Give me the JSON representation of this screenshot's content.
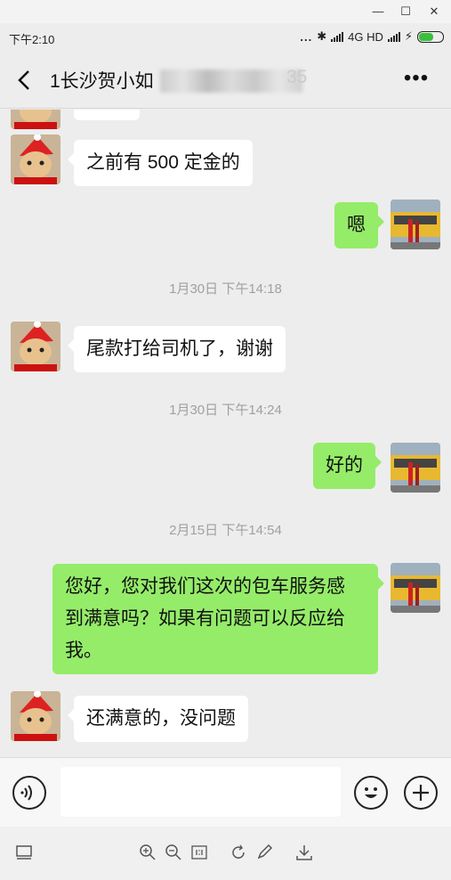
{
  "status_bar": {
    "time": "下午2:10",
    "dots": "...",
    "network": "4G HD"
  },
  "header": {
    "title": "1长沙贺小如",
    "title_tail": "35"
  },
  "messages": [
    {
      "type": "in",
      "text": "之前有 500 定金的"
    },
    {
      "type": "out",
      "text": "嗯"
    },
    {
      "type": "time",
      "text": "1月30日 下午14:18"
    },
    {
      "type": "in",
      "text": "尾款打给司机了，谢谢"
    },
    {
      "type": "time",
      "text": "1月30日 下午14:24"
    },
    {
      "type": "out",
      "text": "好的"
    },
    {
      "type": "time",
      "text": "2月15日 下午14:54"
    },
    {
      "type": "out",
      "lines": [
        "您好，您对我们这次的包车服务感",
        "到满意吗？如果有问题可以反应给",
        "我。"
      ]
    },
    {
      "type": "in",
      "text": "还满意的，没问题"
    }
  ],
  "icons": {
    "back": "back-arrow-icon",
    "more": "more-dots-icon",
    "voice": "voice-icon",
    "emoji": "emoji-icon",
    "plus": "plus-icon"
  },
  "colors": {
    "out_bubble": "#95ec69",
    "in_bubble": "#ffffff",
    "background": "#ededed"
  }
}
